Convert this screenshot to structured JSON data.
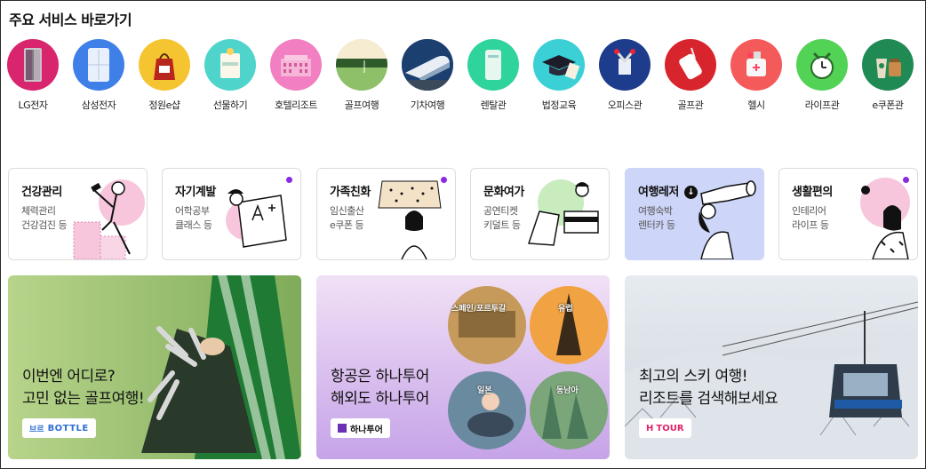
{
  "section": {
    "title": "주요 서비스 바로가기"
  },
  "services": [
    {
      "label": "LG전자",
      "icon": "lg-fridge-icon",
      "bg": "#d9256e"
    },
    {
      "label": "삼성전자",
      "icon": "samsung-fridge-icon",
      "bg": "#3f7fe8"
    },
    {
      "label": "정원e샵",
      "icon": "gift-bag-icon",
      "bg": "#f5c431"
    },
    {
      "label": "선물하기",
      "icon": "gift-card-icon",
      "bg": "#4fd4cc"
    },
    {
      "label": "호텔리조트",
      "icon": "hotel-icon",
      "bg": "#f17fc1"
    },
    {
      "label": "골프여행",
      "icon": "golf-course-icon",
      "bg": "#8ec06a"
    },
    {
      "label": "기차여행",
      "icon": "train-icon",
      "bg": "#2d6fb0"
    },
    {
      "label": "렌탈관",
      "icon": "purifier-icon",
      "bg": "#2fd39c"
    },
    {
      "label": "법정교육",
      "icon": "graduation-cap-icon",
      "bg": "#3bd0d6"
    },
    {
      "label": "오피스관",
      "icon": "office-supplies-icon",
      "bg": "#1d3c8c"
    },
    {
      "label": "골프관",
      "icon": "golf-bag-icon",
      "bg": "#d8242d"
    },
    {
      "label": "헬시",
      "icon": "health-icon",
      "bg": "#f45a5a"
    },
    {
      "label": "라이프관",
      "icon": "clock-icon",
      "bg": "#52d356"
    },
    {
      "label": "e쿠폰관",
      "icon": "coffee-coupon-icon",
      "bg": "#1f8a54"
    }
  ],
  "categories": [
    {
      "title": "건강관리",
      "sub1": "체력관리",
      "sub2": "건강검진 등",
      "dot": false
    },
    {
      "title": "자기계발",
      "sub1": "어학공부",
      "sub2": "클래스 등",
      "dot": true
    },
    {
      "title": "가족친화",
      "sub1": "임신출산",
      "sub2": "e쿠폰 등",
      "dot": true
    },
    {
      "title": "문화여가",
      "sub1": "공연티켓",
      "sub2": "키덜트 등",
      "dot": false
    },
    {
      "title": "여행레저",
      "sub1": "여행숙박",
      "sub2": "렌터카 등",
      "dot": false,
      "active": true,
      "icon": "download-arrow-icon"
    },
    {
      "title": "생활편의",
      "sub1": "인테리어",
      "sub2": "라이프 등",
      "dot": true
    }
  ],
  "banners": [
    {
      "headline": "이번엔 어디로?\n고민 없는 골프여행!",
      "badge": "BOTTLE",
      "badge_prefix": "브르",
      "badge_color": "#2f6fd0"
    },
    {
      "headline": "항공은 하나투어\n해외도 하나투어",
      "badge": "하나투어",
      "badge_color": "#6b2fb3",
      "circles": [
        "스페인/포르투갈",
        "유럽",
        "일본",
        "동남아"
      ]
    },
    {
      "headline": "최고의 스키 여행!\n리조트를 검색해보세요",
      "badge": "TOUR",
      "badge_prefix": "H",
      "badge_color": "#e0246b"
    }
  ]
}
